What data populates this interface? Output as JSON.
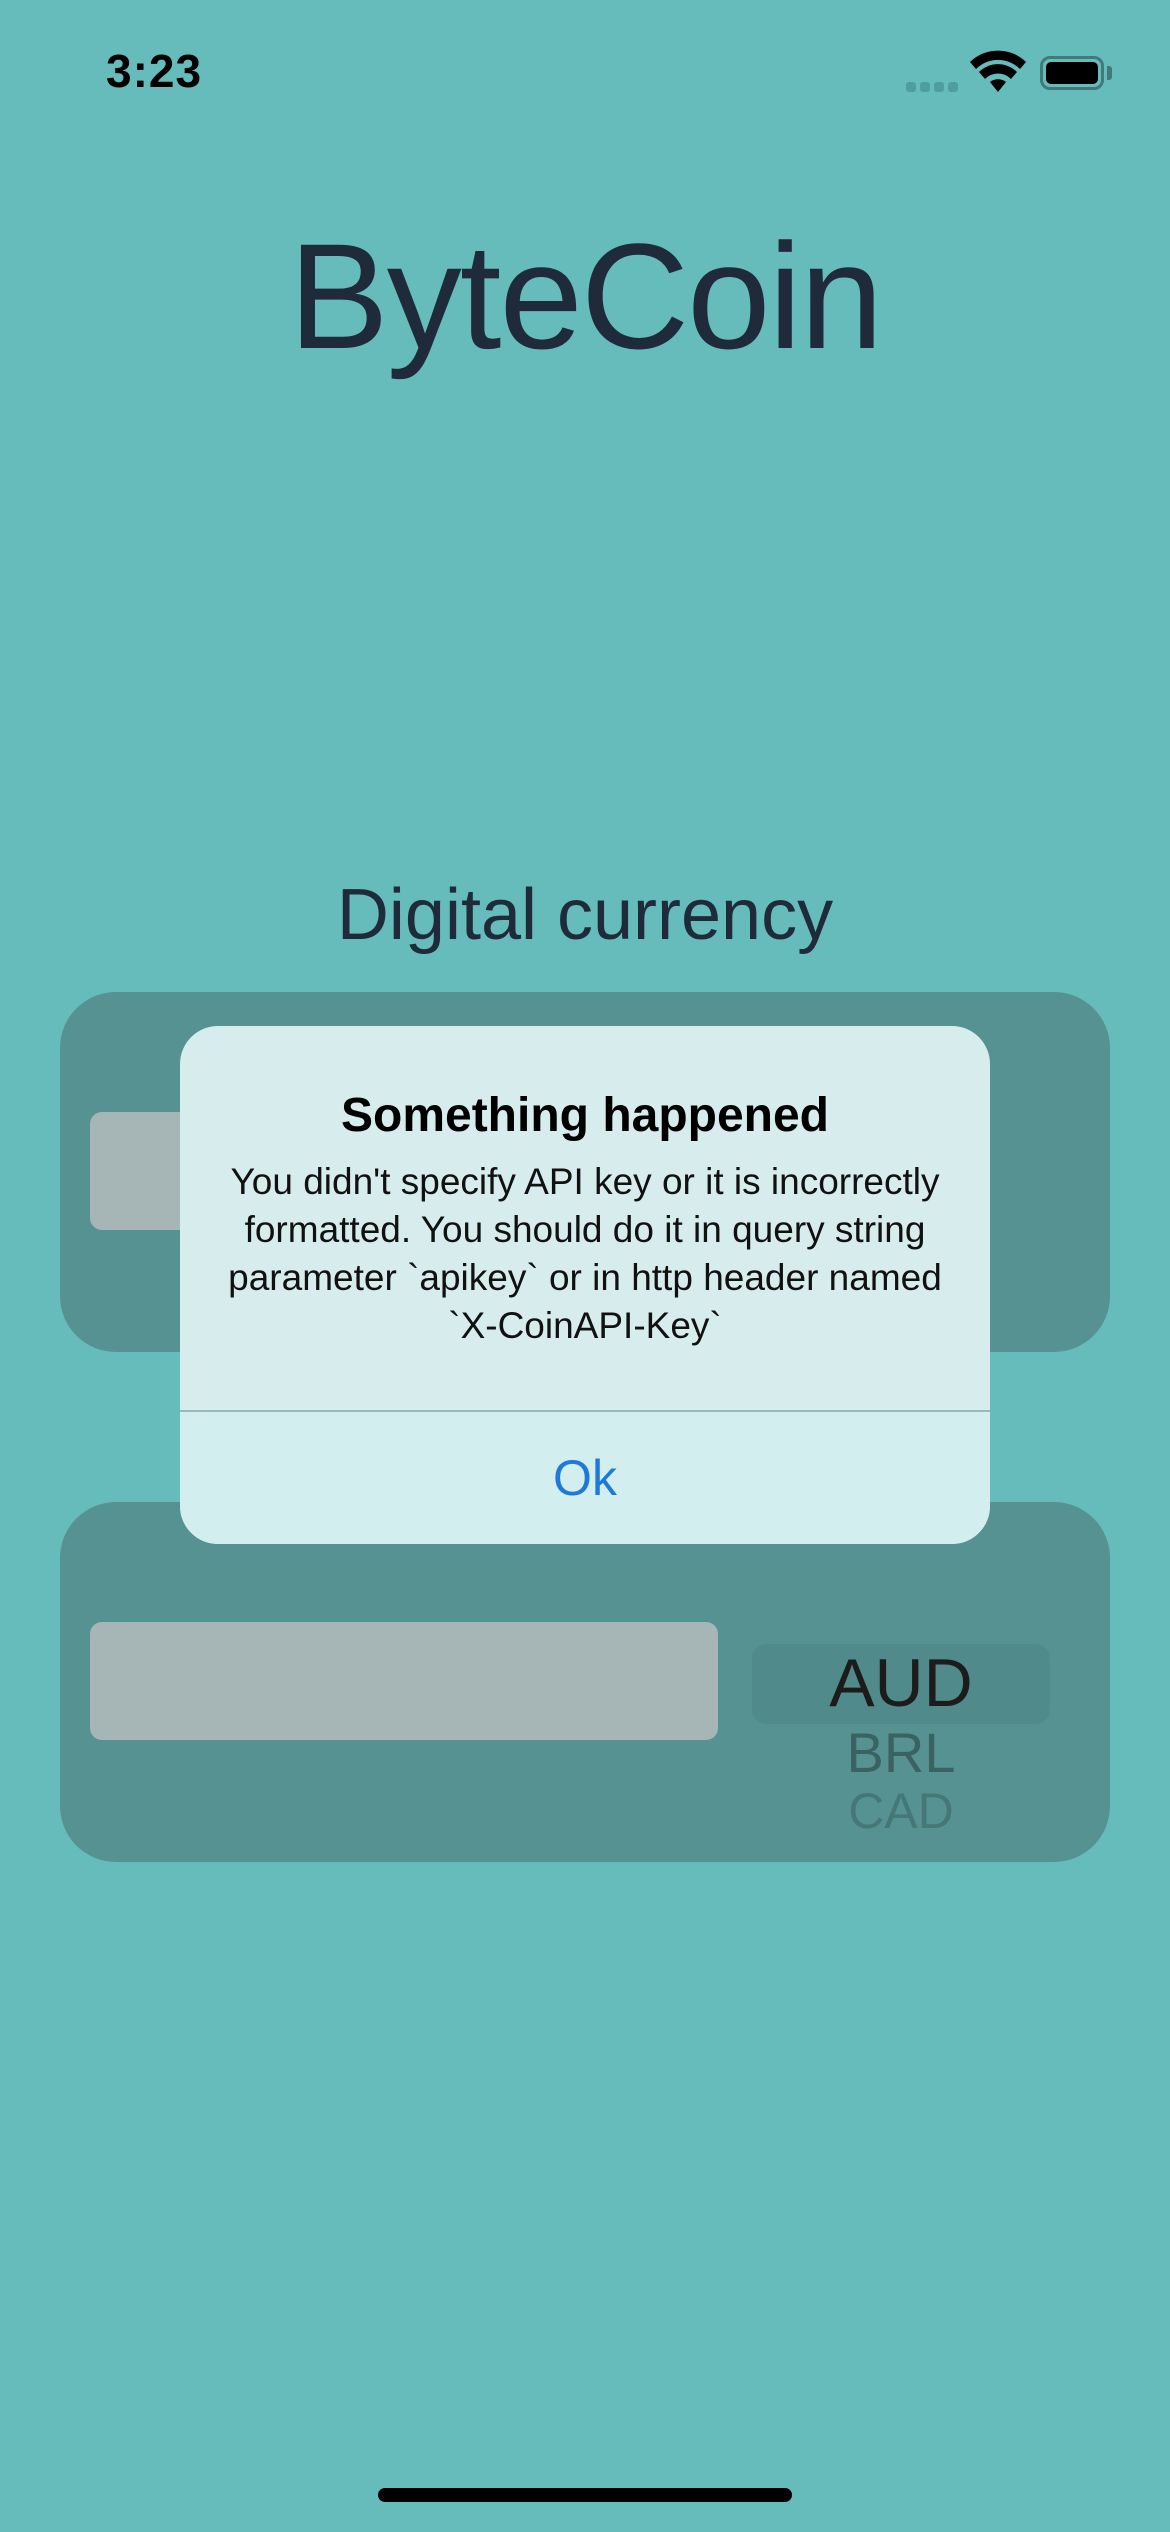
{
  "status_bar": {
    "time": "3:23"
  },
  "app": {
    "title": "ByteCoin",
    "subtitle": "Digital currency",
    "background_color": "#66BBBB"
  },
  "converter": {
    "currency_picker": {
      "selected": "AUD",
      "next": "BRL",
      "next2": "CAD"
    }
  },
  "alert": {
    "title": "Something happened",
    "message": "You didn't specify API key or it is incorrectly formatted. You should do it in query string parameter `apikey` or in http header named `X-CoinAPI-Key`",
    "button_label": "Ok",
    "button_color": "#1E79DA"
  },
  "icons": [
    "cellular-signal-icon",
    "wifi-icon",
    "battery-icon"
  ]
}
